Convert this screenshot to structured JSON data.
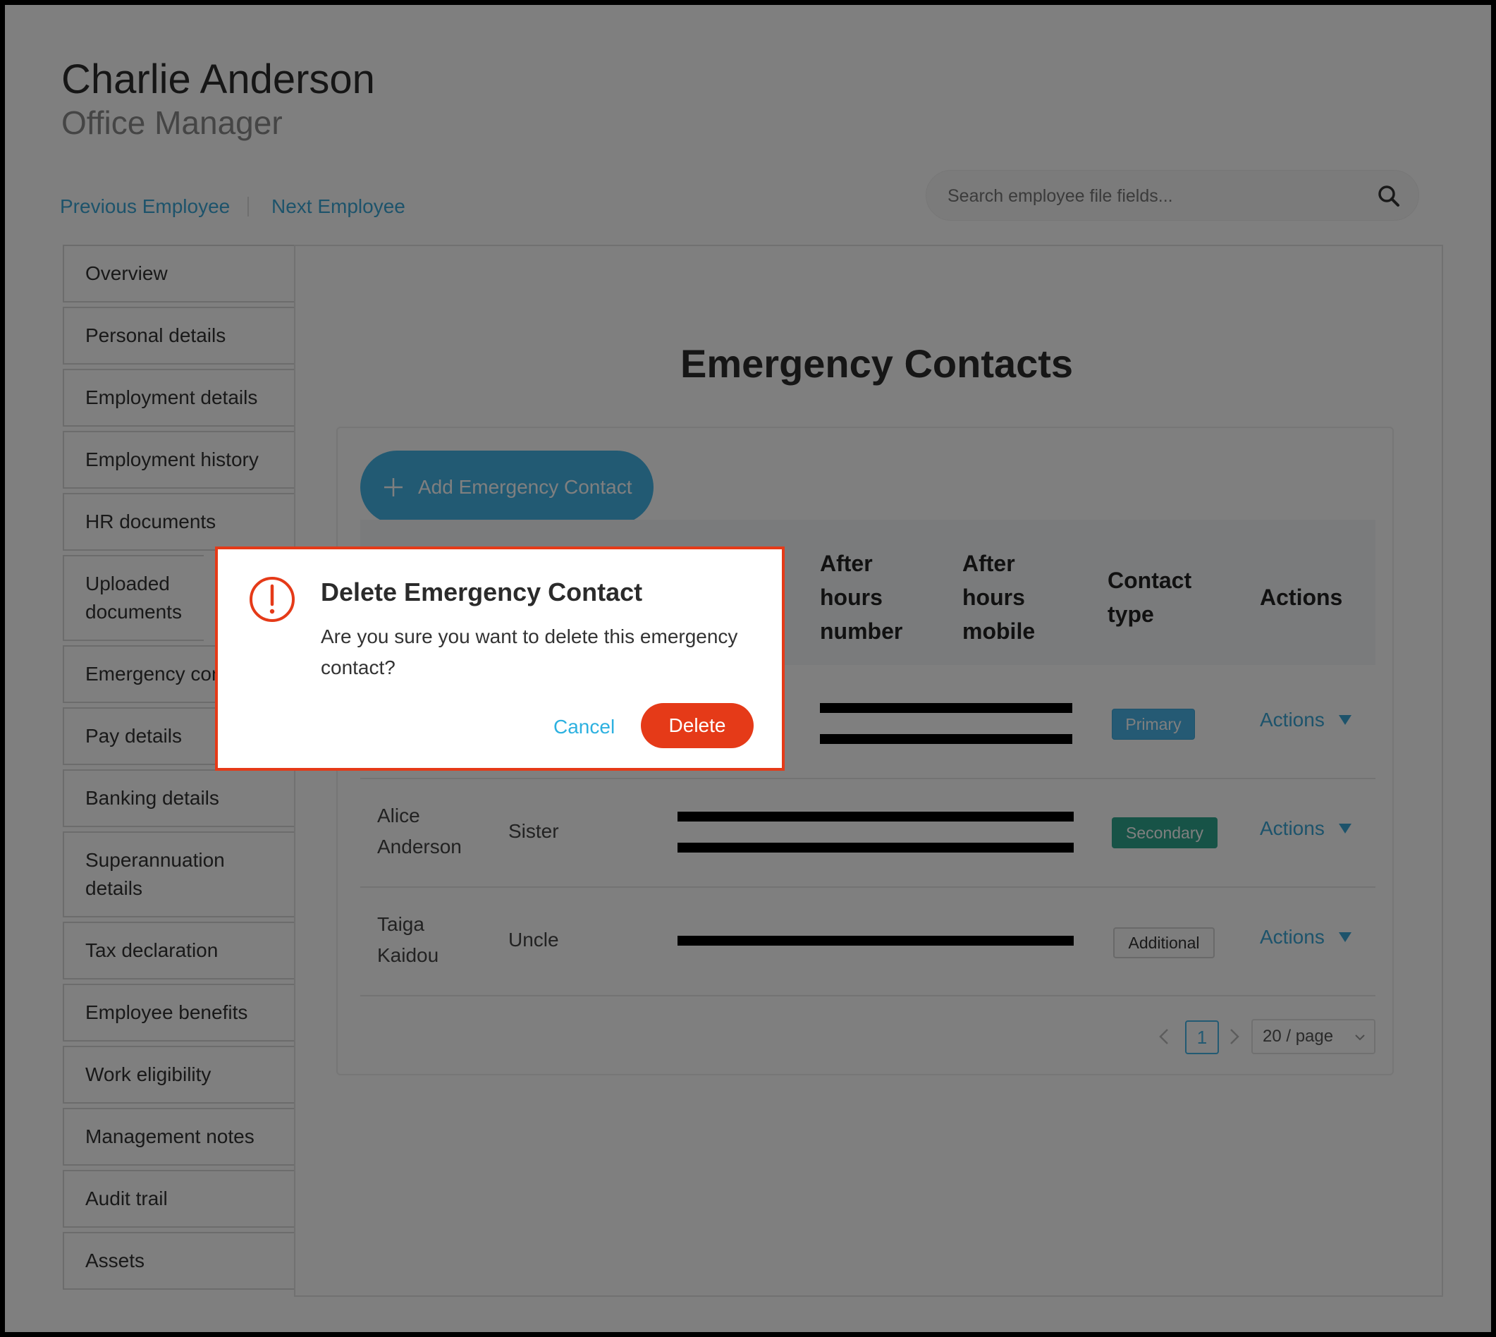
{
  "employee": {
    "name": "Charlie Anderson",
    "role": "Office Manager"
  },
  "nav": {
    "prev_label": "Previous Employee",
    "next_label": "Next Employee"
  },
  "search": {
    "placeholder": "Search employee file fields..."
  },
  "sidebar": {
    "items": [
      {
        "label": "Overview"
      },
      {
        "label": "Personal details"
      },
      {
        "label": "Employment details"
      },
      {
        "label": "Employment history"
      },
      {
        "label": "HR documents"
      },
      {
        "label": "Uploaded documents"
      },
      {
        "label": "Emergency contacts"
      },
      {
        "label": "Pay details"
      },
      {
        "label": "Banking details"
      },
      {
        "label": "Superannuation details"
      },
      {
        "label": "Tax declaration"
      },
      {
        "label": "Employee benefits"
      },
      {
        "label": "Work eligibility"
      },
      {
        "label": "Management notes"
      },
      {
        "label": "Audit trail"
      },
      {
        "label": "Assets"
      }
    ]
  },
  "main": {
    "title": "Emergency Contacts",
    "add_button": "Add Emergency Contact",
    "columns": {
      "after_hours_number": "After hours number",
      "after_hours_mobile": "After hours mobile",
      "contact_type": "Contact type",
      "actions": "Actions"
    },
    "rows": [
      {
        "name": "",
        "relationship": "",
        "contact_type": "Primary",
        "actions": "Actions"
      },
      {
        "name": "Alice Anderson",
        "relationship": "Sister",
        "contact_type": "Secondary",
        "actions": "Actions"
      },
      {
        "name": "Taiga Kaidou",
        "relationship": "Uncle",
        "contact_type": "Additional",
        "actions": "Actions"
      }
    ],
    "pagination": {
      "current": "1",
      "page_size": "20 / page"
    }
  },
  "dialog": {
    "title": "Delete Emergency Contact",
    "message": "Are you sure you want to delete this emergency contact?",
    "cancel_label": "Cancel",
    "delete_label": "Delete"
  },
  "colors": {
    "accent": "#45b4e6",
    "danger": "#e53a18",
    "secondary_tag": "#2fa78e"
  }
}
